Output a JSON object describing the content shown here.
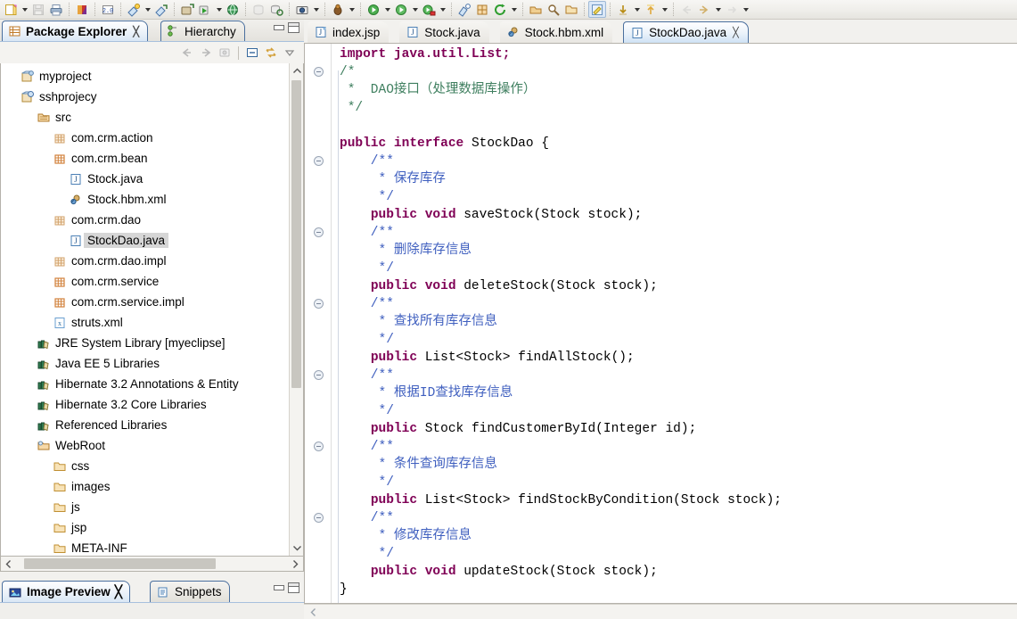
{
  "toolbar": {
    "groups": [
      {
        "name": "file-group",
        "items": [
          {
            "icon": "new-wizard-icon",
            "label": "New",
            "dropdown": true,
            "enabled": true
          },
          {
            "icon": "save-icon",
            "label": "Save",
            "dropdown": false,
            "enabled": false
          },
          {
            "icon": "print-icon",
            "label": "Print",
            "dropdown": false,
            "enabled": true
          }
        ]
      },
      {
        "name": "myeclipse-group",
        "items": [
          {
            "icon": "myeclipse-perspective-icon",
            "label": "MyEclipse",
            "dropdown": false,
            "enabled": true
          }
        ]
      },
      {
        "name": "j2ee-version-group",
        "items": [
          {
            "icon": "j2ee-20-icon",
            "label": "J2EE 2.0",
            "dropdown": false,
            "enabled": true
          }
        ]
      },
      {
        "name": "deploy-group",
        "items": [
          {
            "icon": "deploy-icon",
            "label": "Deploy MyEclipse J2EE Project",
            "dropdown": true,
            "enabled": true
          },
          {
            "icon": "undeploy-icon",
            "label": "Manage Deployments",
            "dropdown": false,
            "enabled": true
          }
        ]
      },
      {
        "name": "server-group",
        "items": [
          {
            "icon": "add-server-icon",
            "label": "Add Server",
            "dropdown": false,
            "enabled": true
          },
          {
            "icon": "run-server-icon",
            "label": "Run Server",
            "dropdown": true,
            "enabled": true
          },
          {
            "icon": "web-browser-icon",
            "label": "Open Web Browser",
            "dropdown": false,
            "enabled": true
          }
        ]
      },
      {
        "name": "db-group",
        "items": [
          {
            "icon": "db-browser-icon",
            "label": "DB Browser",
            "dropdown": false,
            "enabled": false
          },
          {
            "icon": "db-refresh-icon",
            "label": "Refresh Database",
            "dropdown": false,
            "enabled": true
          }
        ]
      },
      {
        "name": "snapshot-group",
        "items": [
          {
            "icon": "snapshot-icon",
            "label": "Snapshot",
            "dropdown": true,
            "enabled": true
          }
        ]
      },
      {
        "name": "debug-group",
        "items": [
          {
            "icon": "debug-icon",
            "label": "Debug",
            "dropdown": true,
            "enabled": true
          }
        ]
      },
      {
        "name": "run-group",
        "items": [
          {
            "icon": "run-icon",
            "label": "Run",
            "dropdown": true,
            "enabled": true
          },
          {
            "icon": "run-green-icon",
            "label": "Run As",
            "dropdown": true,
            "enabled": true
          },
          {
            "icon": "run-config-icon",
            "label": "Run Configurations",
            "dropdown": true,
            "enabled": true
          }
        ]
      },
      {
        "name": "external-tools-group",
        "items": [
          {
            "icon": "external-tools-icon",
            "label": "External Tools",
            "dropdown": false,
            "enabled": true
          },
          {
            "icon": "new-package-icon",
            "label": "New Java Package",
            "dropdown": false,
            "enabled": true
          },
          {
            "icon": "refresh-icon",
            "label": "Refresh",
            "dropdown": true,
            "enabled": true
          }
        ]
      },
      {
        "name": "open-group",
        "items": [
          {
            "icon": "open-type-icon",
            "label": "Open Type",
            "dropdown": false,
            "enabled": true
          },
          {
            "icon": "search-icon",
            "label": "Search",
            "dropdown": false,
            "enabled": true
          },
          {
            "icon": "open-task-icon",
            "label": "Open Task",
            "dropdown": false,
            "enabled": true
          }
        ]
      },
      {
        "name": "editor-group",
        "items": [
          {
            "icon": "toggle-markup-icon",
            "label": "Toggle Markup",
            "dropdown": false,
            "enabled": true,
            "active": true
          }
        ]
      },
      {
        "name": "annotation-group",
        "items": [
          {
            "icon": "next-annotation-icon",
            "label": "Next Annotation",
            "dropdown": true,
            "enabled": true
          },
          {
            "icon": "previous-annotation-icon",
            "label": "Previous Annotation",
            "dropdown": true,
            "enabled": true
          }
        ]
      },
      {
        "name": "navigate-group",
        "items": [
          {
            "icon": "back-icon",
            "label": "Back",
            "dropdown": false,
            "enabled": false
          },
          {
            "icon": "forward-icon",
            "label": "Forward",
            "dropdown": true,
            "enabled": true
          },
          {
            "icon": "next-edit-icon",
            "label": "Next Edit Location",
            "dropdown": true,
            "enabled": false
          }
        ]
      }
    ]
  },
  "left_panel": {
    "tabs": [
      {
        "label": "Package Explorer",
        "icon": "package-explorer-icon",
        "selected": true,
        "closable": true
      },
      {
        "label": "Hierarchy",
        "icon": "hierarchy-icon",
        "selected": false,
        "closable": false
      }
    ],
    "window_buttons": [
      {
        "name": "minimize-button",
        "label": "Minimize"
      },
      {
        "name": "maximize-button",
        "label": "Maximize"
      }
    ],
    "view_toolbar": [
      {
        "icon": "back-arrow-icon",
        "label": "Back",
        "enabled": false
      },
      {
        "icon": "forward-arrow-icon",
        "label": "Forward",
        "enabled": false
      },
      {
        "icon": "home-icon",
        "label": "Home",
        "enabled": false
      },
      {
        "icon": "collapse-all-icon",
        "label": "Collapse All",
        "enabled": true
      },
      {
        "icon": "link-with-editor-icon",
        "label": "Link with Editor",
        "enabled": true
      },
      {
        "icon": "view-menu-icon",
        "label": "View Menu",
        "enabled": true
      }
    ],
    "tree": [
      {
        "label": "myproject",
        "indent": 0,
        "icon": "java-project-icon",
        "selected": false
      },
      {
        "label": "sshprojecy",
        "indent": 0,
        "icon": "web-project-icon",
        "selected": false
      },
      {
        "label": "src",
        "indent": 1,
        "icon": "source-folder-icon",
        "selected": false
      },
      {
        "label": "com.crm.action",
        "indent": 2,
        "icon": "package-empty-icon",
        "selected": false
      },
      {
        "label": "com.crm.bean",
        "indent": 2,
        "icon": "package-icon",
        "selected": false
      },
      {
        "label": "Stock.java",
        "indent": 3,
        "icon": "java-file-icon",
        "selected": false
      },
      {
        "label": "Stock.hbm.xml",
        "indent": 3,
        "icon": "hbm-xml-icon",
        "selected": false
      },
      {
        "label": "com.crm.dao",
        "indent": 2,
        "icon": "package-empty-icon",
        "selected": false
      },
      {
        "label": "StockDao.java",
        "indent": 3,
        "icon": "java-file-icon",
        "selected": true
      },
      {
        "label": "com.crm.dao.impl",
        "indent": 2,
        "icon": "package-empty-icon",
        "selected": false
      },
      {
        "label": "com.crm.service",
        "indent": 2,
        "icon": "package-icon",
        "selected": false
      },
      {
        "label": "com.crm.service.impl",
        "indent": 2,
        "icon": "package-icon",
        "selected": false
      },
      {
        "label": "struts.xml",
        "indent": 2,
        "icon": "xml-file-icon",
        "selected": false
      },
      {
        "label": "JRE System Library [myeclipse]",
        "indent": 1,
        "icon": "library-icon",
        "selected": false
      },
      {
        "label": "Java EE 5 Libraries",
        "indent": 1,
        "icon": "library-icon",
        "selected": false
      },
      {
        "label": "Hibernate 3.2 Annotations & Entity",
        "indent": 1,
        "icon": "library-icon",
        "selected": false
      },
      {
        "label": "Hibernate 3.2 Core Libraries",
        "indent": 1,
        "icon": "library-icon",
        "selected": false
      },
      {
        "label": "Referenced Libraries",
        "indent": 1,
        "icon": "library-icon",
        "selected": false
      },
      {
        "label": "WebRoot",
        "indent": 1,
        "icon": "webroot-folder-icon",
        "selected": false
      },
      {
        "label": "css",
        "indent": 2,
        "icon": "folder-icon",
        "selected": false
      },
      {
        "label": "images",
        "indent": 2,
        "icon": "folder-icon",
        "selected": false
      },
      {
        "label": "js",
        "indent": 2,
        "icon": "folder-icon",
        "selected": false
      },
      {
        "label": "jsp",
        "indent": 2,
        "icon": "folder-icon",
        "selected": false
      },
      {
        "label": "META-INF",
        "indent": 2,
        "icon": "folder-icon",
        "selected": false
      }
    ]
  },
  "bottom_panel": {
    "tabs": [
      {
        "label": "Image Preview",
        "icon": "image-preview-icon",
        "selected": true,
        "closable": true
      },
      {
        "label": "Snippets",
        "icon": "snippets-icon",
        "selected": false,
        "closable": false
      }
    ]
  },
  "editor": {
    "tabs": [
      {
        "label": "index.jsp",
        "icon": "jsp-file-icon",
        "active": false,
        "closable": false
      },
      {
        "label": "Stock.java",
        "icon": "java-file-icon",
        "active": false,
        "closable": false
      },
      {
        "label": "Stock.hbm.xml",
        "icon": "hbm-xml-icon",
        "active": false,
        "closable": false
      },
      {
        "label": "StockDao.java",
        "icon": "java-file-icon",
        "active": true,
        "closable": true
      }
    ],
    "filename": "StockDao.java",
    "code_lines": [
      {
        "fold": false,
        "clipped": true,
        "segments": [
          {
            "t": "import java.util.List;",
            "c": "clipped"
          }
        ]
      },
      {
        "fold": true,
        "segments": [
          {
            "t": "/*",
            "c": "cmt"
          }
        ]
      },
      {
        "fold": false,
        "segments": [
          {
            "t": " *  DAO接口（处理数据库操作）",
            "c": "cmt"
          }
        ]
      },
      {
        "fold": false,
        "segments": [
          {
            "t": " */",
            "c": "cmt"
          }
        ]
      },
      {
        "fold": false,
        "segments": [
          {
            "t": "",
            "c": "pl"
          }
        ]
      },
      {
        "fold": false,
        "segments": [
          {
            "t": "public interface ",
            "c": "kw"
          },
          {
            "t": "StockDao {",
            "c": "pl"
          }
        ]
      },
      {
        "fold": true,
        "segments": [
          {
            "t": "    /**",
            "c": "jdoc"
          }
        ]
      },
      {
        "fold": false,
        "segments": [
          {
            "t": "     * 保存库存",
            "c": "jdoc"
          }
        ]
      },
      {
        "fold": false,
        "segments": [
          {
            "t": "     */",
            "c": "jdoc"
          }
        ]
      },
      {
        "fold": false,
        "segments": [
          {
            "t": "    ",
            "c": "pl"
          },
          {
            "t": "public void ",
            "c": "kw"
          },
          {
            "t": "saveStock(Stock stock);",
            "c": "pl"
          }
        ]
      },
      {
        "fold": true,
        "segments": [
          {
            "t": "    /**",
            "c": "jdoc"
          }
        ]
      },
      {
        "fold": false,
        "segments": [
          {
            "t": "     * 删除库存信息",
            "c": "jdoc"
          }
        ]
      },
      {
        "fold": false,
        "segments": [
          {
            "t": "     */",
            "c": "jdoc"
          }
        ]
      },
      {
        "fold": false,
        "segments": [
          {
            "t": "    ",
            "c": "pl"
          },
          {
            "t": "public void ",
            "c": "kw"
          },
          {
            "t": "deleteStock(Stock stock);",
            "c": "pl"
          }
        ]
      },
      {
        "fold": true,
        "segments": [
          {
            "t": "    /**",
            "c": "jdoc"
          }
        ]
      },
      {
        "fold": false,
        "segments": [
          {
            "t": "     * 查找所有库存信息",
            "c": "jdoc"
          }
        ]
      },
      {
        "fold": false,
        "segments": [
          {
            "t": "     */",
            "c": "jdoc"
          }
        ]
      },
      {
        "fold": false,
        "segments": [
          {
            "t": "    ",
            "c": "pl"
          },
          {
            "t": "public ",
            "c": "kw"
          },
          {
            "t": "List<Stock> findAllStock();",
            "c": "pl"
          }
        ]
      },
      {
        "fold": true,
        "segments": [
          {
            "t": "    /**",
            "c": "jdoc"
          }
        ]
      },
      {
        "fold": false,
        "segments": [
          {
            "t": "     * 根据ID查找库存信息",
            "c": "jdoc"
          }
        ]
      },
      {
        "fold": false,
        "segments": [
          {
            "t": "     */",
            "c": "jdoc"
          }
        ]
      },
      {
        "fold": false,
        "segments": [
          {
            "t": "    ",
            "c": "pl"
          },
          {
            "t": "public ",
            "c": "kw"
          },
          {
            "t": "Stock findCustomerById(Integer id);",
            "c": "pl"
          }
        ]
      },
      {
        "fold": true,
        "segments": [
          {
            "t": "    /**",
            "c": "jdoc"
          }
        ]
      },
      {
        "fold": false,
        "segments": [
          {
            "t": "     * 条件查询库存信息",
            "c": "jdoc"
          }
        ]
      },
      {
        "fold": false,
        "segments": [
          {
            "t": "     */",
            "c": "jdoc"
          }
        ]
      },
      {
        "fold": false,
        "segments": [
          {
            "t": "    ",
            "c": "pl"
          },
          {
            "t": "public ",
            "c": "kw"
          },
          {
            "t": "List<Stock> findStockByCondition(Stock stock);",
            "c": "pl"
          }
        ]
      },
      {
        "fold": true,
        "segments": [
          {
            "t": "    /**",
            "c": "jdoc"
          }
        ]
      },
      {
        "fold": false,
        "segments": [
          {
            "t": "     * 修改库存信息",
            "c": "jdoc"
          }
        ]
      },
      {
        "fold": false,
        "segments": [
          {
            "t": "     */",
            "c": "jdoc"
          }
        ]
      },
      {
        "fold": false,
        "segments": [
          {
            "t": "    ",
            "c": "pl"
          },
          {
            "t": "public void ",
            "c": "kw"
          },
          {
            "t": "updateStock(Stock stock);",
            "c": "pl"
          }
        ]
      },
      {
        "fold": false,
        "segments": [
          {
            "t": "}",
            "c": "pl"
          }
        ]
      }
    ]
  },
  "colors": {
    "keyword": "#7f0055",
    "comment": "#3f7f5f",
    "javadoc": "#3f5fbf",
    "plain": "#000000",
    "selection": "#d6d6d6",
    "tab_active_border": "#4a6f9e",
    "panel_bg": "#f2f1ee",
    "editor_bg": "#ffffff"
  }
}
